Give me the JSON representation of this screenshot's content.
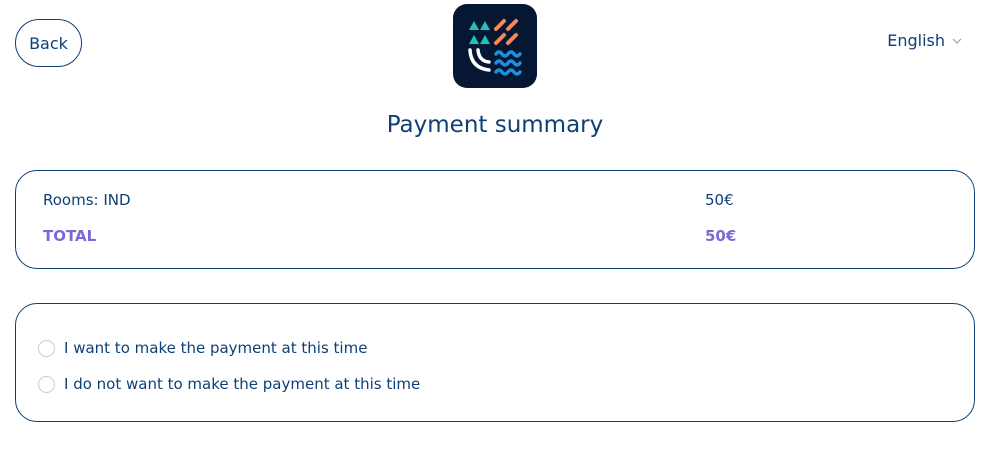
{
  "header": {
    "back_label": "Back",
    "language": "English"
  },
  "logo": {
    "icon": "waves-triangles-logo-icon",
    "colors": {
      "background": "#061733",
      "teal": "#1fc2b5",
      "orange": "#f08a5d",
      "blue": "#1e8ee0",
      "white": "#ffffff"
    }
  },
  "page": {
    "title": "Payment summary"
  },
  "summary": {
    "rows": [
      {
        "label": "Rooms: IND",
        "amount": "50€"
      },
      {
        "label": "TOTAL",
        "amount": "50€"
      }
    ]
  },
  "payment_options": [
    {
      "label": "I want to make the payment at this time",
      "selected": false
    },
    {
      "label": "I do not want to make the payment at this time",
      "selected": false
    }
  ],
  "colors": {
    "primary": "#0f3f78",
    "accent": "#7b6ad6",
    "radio_border": "#c9cdd6"
  }
}
